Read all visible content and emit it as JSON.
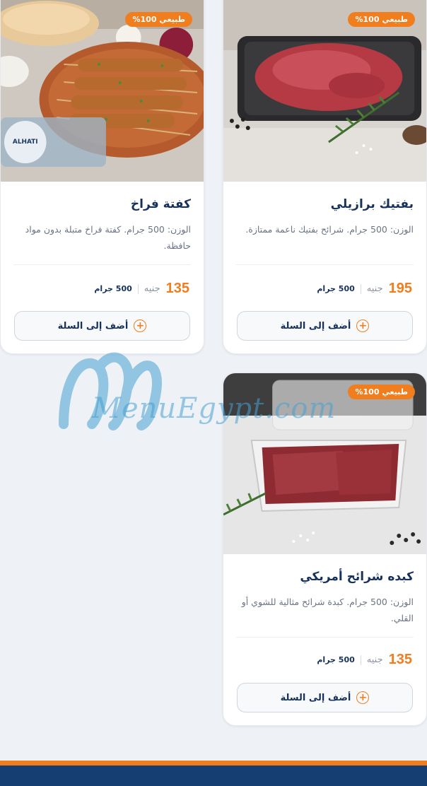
{
  "products": [
    {
      "title": "بفتيك برازيلي",
      "badge": "طبيعي 100%",
      "description": "الوزن: 500 جرام. شرائح بفتيك ناعمة ممتازة.",
      "price": "195",
      "currency": "جنيه",
      "weight": "500 جرام",
      "add_label": "أضف إلى السلة",
      "image_icon": "beef-steak-tray-image"
    },
    {
      "title": "كفتة فراخ",
      "badge": "طبيعي 100%",
      "description": "الوزن: 500 جرام. كفتة فراخ متبلة بدون مواد حافظة.",
      "price": "135",
      "currency": "جنيه",
      "weight": "500 جرام",
      "add_label": "أضف إلى السلة",
      "image_icon": "chicken-kofta-skewers-image"
    },
    {
      "title": "كبده شرائح أمريكي",
      "badge": "طبيعي 100%",
      "description": "الوزن: 500 جرام. كبدة شرائح مثالية للشوي أو القلي.",
      "price": "135",
      "currency": "جنيه",
      "weight": "500 جرام",
      "add_label": "أضف إلى السلة",
      "image_icon": "liver-slices-container-image"
    }
  ],
  "watermark": {
    "text": "MenuEgypt.com"
  },
  "colors": {
    "accent": "#f07d1e",
    "navy": "#16325c",
    "footer": "#153e72"
  }
}
